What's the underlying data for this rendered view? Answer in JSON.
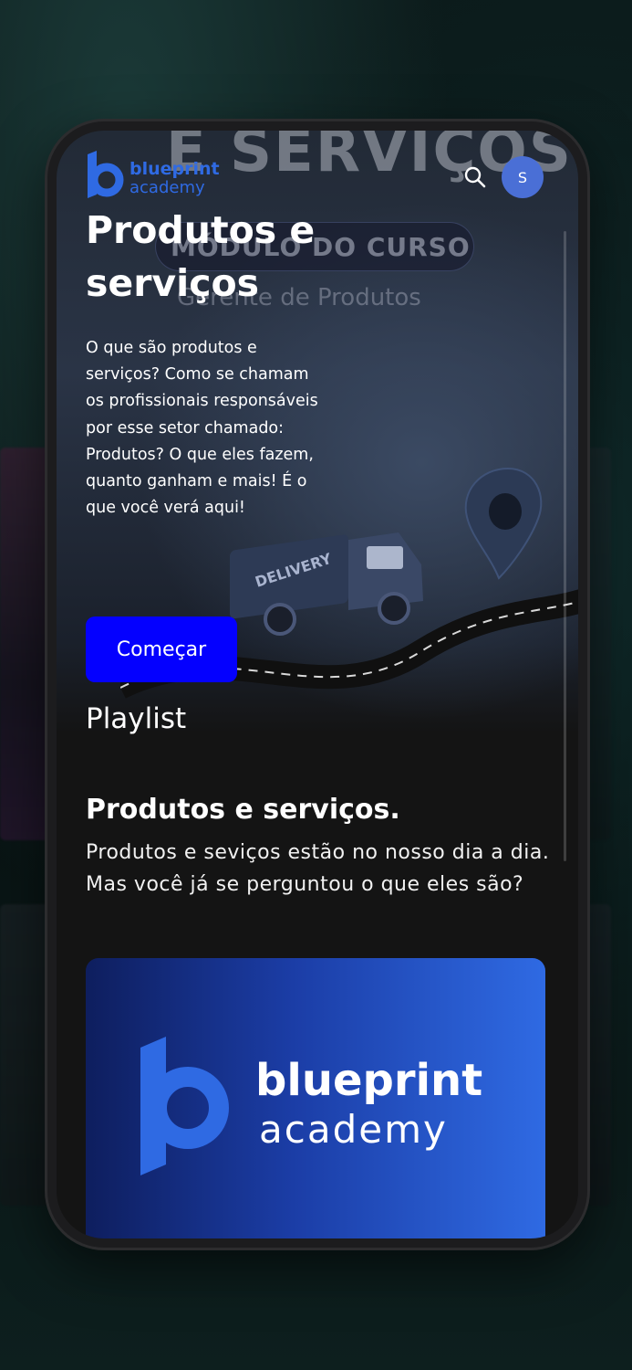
{
  "hero": {
    "bg_title": "E SERVIÇOS",
    "bg_badge": "MÓDULO DO CURSO",
    "bg_subtitle": "Gerente de Produtos",
    "truck_label": "DELIVERY"
  },
  "header": {
    "logo_line1": "blueprint",
    "logo_line2": "academy",
    "avatar_initial": "S"
  },
  "course": {
    "title": "Produtos e serviços",
    "description": "O que são produtos e serviços? Como se chamam os profissionais responsáveis por esse setor chamado: Produtos? O que eles fazem, quanto ganham e mais! É o que você verá aqui!",
    "start_button": "Começar"
  },
  "playlist": {
    "label": "Playlist",
    "item_title": "Produtos e serviços.",
    "item_description": "Produtos e seviços estão no nosso dia a dia. Mas você já se perguntou o que eles são?",
    "thumb_logo_line1": "blueprint",
    "thumb_logo_line2": "academy"
  },
  "colors": {
    "brand_blue": "#0400ff",
    "logo_blue": "#2f6ae3",
    "avatar": "#4a6fd6"
  },
  "icons": [
    "search-icon",
    "blueprint-logo-icon"
  ]
}
